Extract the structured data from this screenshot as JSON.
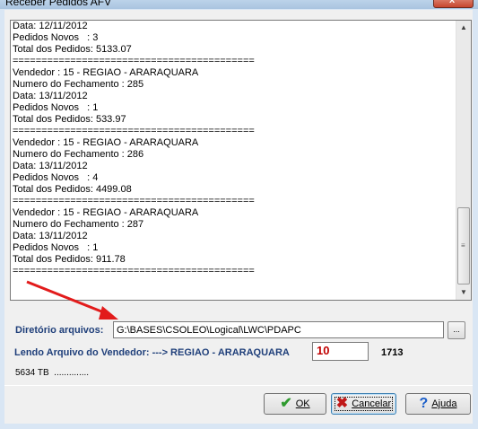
{
  "window": {
    "title": "Receber Pedidos AFV",
    "close_glyph": "x"
  },
  "log": {
    "lines": [
      "Data: 12/11/2012",
      "Pedidos Novos   : 3",
      "Total dos Pedidos: 5133.07",
      "==========================================",
      "Vendedor : 15 - REGIAO - ARARAQUARA",
      "Numero do Fechamento : 285",
      "Data: 13/11/2012",
      "Pedidos Novos   : 1",
      "Total dos Pedidos: 533.97",
      "==========================================",
      "Vendedor : 15 - REGIAO - ARARAQUARA",
      "Numero do Fechamento : 286",
      "Data: 13/11/2012",
      "Pedidos Novos   : 4",
      "Total dos Pedidos: 4499.08",
      "==========================================",
      "Vendedor : 15 - REGIAO - ARARAQUARA",
      "Numero do Fechamento : 287",
      "Data: 13/11/2012",
      "Pedidos Novos   : 1",
      "Total dos Pedidos: 911.78",
      "=========================================="
    ]
  },
  "directory": {
    "label": "Diretório arquivos:",
    "value": "G:\\BASES\\CSOLEO\\Logical\\LWC\\PDAPC",
    "browse_label": "..."
  },
  "status": {
    "reading_label": "Lendo Arquivo do Vendedor: ---> REGIAO - ARARAQUARA",
    "current_value": "10",
    "total": "1713",
    "progress_text": "5634 TB  .............."
  },
  "buttons": {
    "ok": "OK",
    "cancel": "Cancelar",
    "help": "Ajuda"
  },
  "colors": {
    "annotation_arrow": "#e21b1b",
    "label_text": "#1f3f7a",
    "counter_text": "#c00000"
  }
}
